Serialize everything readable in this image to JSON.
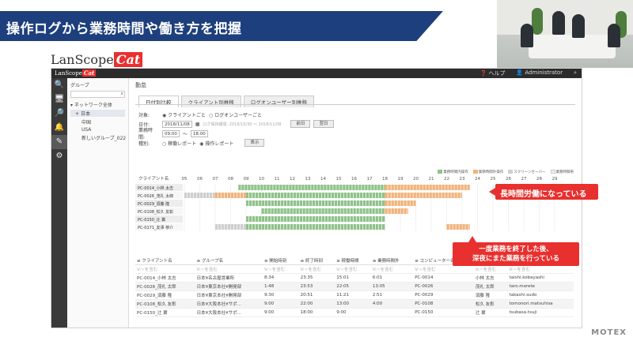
{
  "slide": {
    "title": "操作ログから業務時間や働き方を把握",
    "footer_brand": "MOTEX"
  },
  "logo": {
    "text": "LanScope",
    "cat": "Cat"
  },
  "topbar": {
    "brand": "LanScope",
    "cat": "Cat",
    "help": "ヘルプ",
    "user": "Administrator"
  },
  "nav_icons": [
    "search-icon",
    "monitor-icon",
    "magnifier-icon",
    "bell-icon",
    "edit-icon",
    "gear-icon"
  ],
  "tree": {
    "label": "グループ",
    "nodes": [
      "ネットワーク全体",
      "日本",
      "中国",
      "USA",
      "新しいグループ_022"
    ]
  },
  "main": {
    "title": "勤怠",
    "tabs": [
      "日付別比較",
      "クライアント別推移",
      "ログオンユーザー別推移"
    ]
  },
  "form": {
    "target_label": "対象:",
    "target_opt1": "クライアントごと",
    "target_opt2": "ログオンユーザーごと",
    "date_label": "日付:",
    "date_value": "2018/11/08",
    "date_note": "ログ保持期間: 2018/10/30 ～ 2018/11/08",
    "prev_button": "前日",
    "next_button": "翌日",
    "hours_label": "業務時間:",
    "hours_from": "09:00",
    "hours_to": "18:00",
    "type_label": "種別:",
    "type_opt1": "稼働レポート",
    "type_opt2": "操作レポート",
    "show_button": "表示"
  },
  "legend": [
    "業務時間内操作",
    "業務時間外操作",
    "スクリーンセーバー",
    "業務時間帯"
  ],
  "colors": {
    "inside": "#8fc38a",
    "inside_dark": "#6fae6a",
    "outside": "#f2b27a",
    "saver": "#cfcfcf",
    "accent": "#e8302e",
    "header": "#1e3f7d"
  },
  "timeline": {
    "header_label": "クライアント名",
    "hours": [
      "05",
      "06",
      "07",
      "08",
      "09",
      "10",
      "11",
      "12",
      "13",
      "14",
      "15",
      "16",
      "17",
      "18",
      "19",
      "20",
      "21",
      "22",
      "23",
      "24",
      "25",
      "26",
      "27",
      "28",
      "29"
    ],
    "rows": [
      {
        "name": "PC-0014_小林 太志",
        "segments": [
          [
            8.5,
            18,
            "inside"
          ],
          [
            18,
            23.5,
            "outside"
          ]
        ]
      },
      {
        "name": "PC-0026_茂礼 太郎",
        "segments": [
          [
            5,
            7,
            "saver"
          ],
          [
            7,
            9,
            "outside"
          ],
          [
            9,
            18,
            "inside"
          ],
          [
            18,
            23,
            "outside"
          ]
        ]
      },
      {
        "name": "PC-0029_須藤 隆",
        "segments": [
          [
            9,
            18,
            "inside"
          ],
          [
            18,
            20,
            "outside"
          ]
        ]
      },
      {
        "name": "PC-0108_松久 友彰",
        "segments": [
          [
            10,
            18,
            "inside"
          ],
          [
            18,
            19.5,
            "outside"
          ]
        ]
      },
      {
        "name": "PC-0150_辻 翼",
        "segments": [
          [
            9,
            18,
            "inside"
          ]
        ]
      },
      {
        "name": "PC-0171_友澤 恭介",
        "segments": [
          [
            7,
            9,
            "saver"
          ],
          [
            9,
            18,
            "inside"
          ],
          [
            22,
            23.5,
            "outside"
          ]
        ]
      }
    ]
  },
  "table": {
    "headers": [
      "クライアント名",
      "グループ名",
      "開始時刻",
      "終了時刻",
      "稼働時間",
      "業務時間外",
      "コンピューター名",
      "",
      "ログオンユーザー"
    ],
    "filter": "V:~を含む",
    "rows": [
      [
        "PC-0014_小林 太志",
        "日本¥名古屋営業所",
        "8:34",
        "23:35",
        "15:01",
        "6:01",
        "PC-0014",
        "小林 太志",
        "taishi.kobayashi"
      ],
      [
        "PC-0026_茂礼 太郎",
        "日本¥東京本社¥開発部",
        "1:48",
        "23:53",
        "22:05",
        "13:05",
        "PC-0026",
        "茂礼 太郎",
        "taro.morete"
      ],
      [
        "PC-0029_須藤 隆",
        "日本¥東京本社¥開発部",
        "9:30",
        "20:51",
        "11:21",
        "2:51",
        "PC-0029",
        "須藤 隆",
        "takashi.sudo"
      ],
      [
        "PC-0108_松久 友彰",
        "日本¥大阪本社¥サポ...",
        "9:00",
        "22:00",
        "13:00",
        "4:00",
        "PC-0108",
        "松久 友彰",
        "tomonori.matsuhisa"
      ],
      [
        "PC-0150_辻 翼",
        "日本¥大阪本社¥サポ...",
        "9:00",
        "18:00",
        "9:00",
        "",
        "PC-0150",
        "辻 翼",
        "tsubasa.tsuji"
      ]
    ]
  },
  "annotations": {
    "long_hours": "長時間労働になっている",
    "late_work_1": "一度業務を終了した後、",
    "late_work_2": "深夜にまた業務を行っている"
  }
}
